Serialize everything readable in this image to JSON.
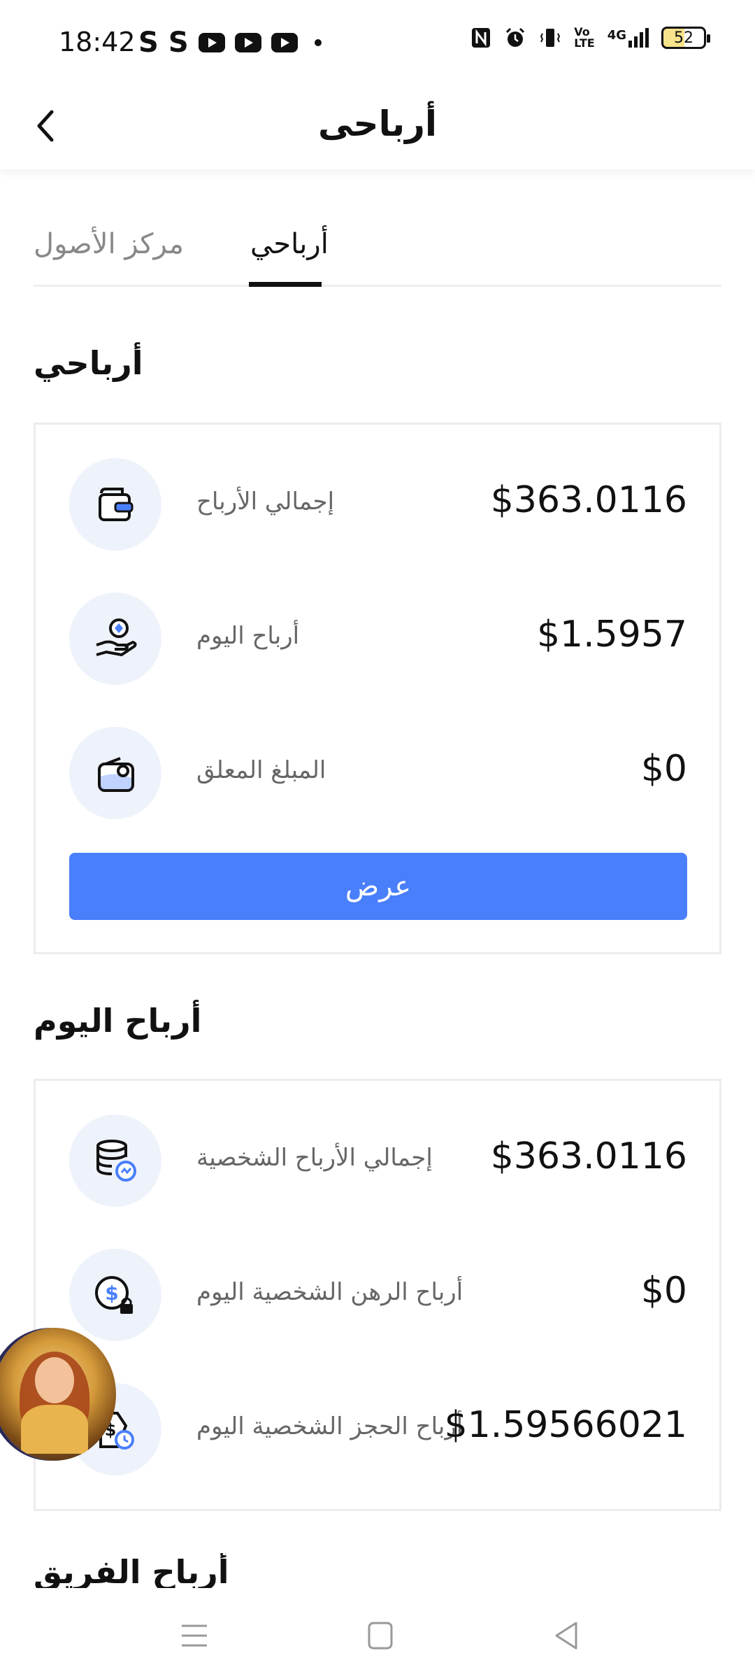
{
  "status_bar": {
    "time": "18:42",
    "left_icons": [
      "S",
      "S"
    ],
    "battery": "52",
    "network": "4G"
  },
  "header": {
    "title": "أرباحى"
  },
  "tabs": [
    {
      "label": "مركز الأصول",
      "active": false
    },
    {
      "label": "أرباحي",
      "active": true
    }
  ],
  "my_earnings": {
    "title": "أرباحي",
    "rows": [
      {
        "label": "إجمالي الأرباح",
        "value": "$363.0116",
        "icon": "wallet-icon"
      },
      {
        "label": "أرباح اليوم",
        "value": "$1.5957",
        "icon": "hand-coin-icon"
      },
      {
        "label": "المبلغ المعلق",
        "value": "$0",
        "icon": "locked-wallet-icon"
      }
    ],
    "button_label": "عرض"
  },
  "today_earnings": {
    "title": "أرباح اليوم",
    "rows": [
      {
        "label": "إجمالي الأرباح الشخصية",
        "value": "$363.0116",
        "icon": "coin-stack-icon"
      },
      {
        "label": "أرباح الرهن الشخصية اليوم",
        "value": "$0",
        "icon": "dollar-lock-icon"
      },
      {
        "label": "أرباح الحجز الشخصية اليوم",
        "value": "$1.59566021",
        "icon": "dollar-clock-icon"
      }
    ]
  },
  "team_earnings": {
    "title": "أرباح الفريق"
  },
  "colors": {
    "accent": "#4a7ffb",
    "icon_bg": "#eef2fb"
  }
}
